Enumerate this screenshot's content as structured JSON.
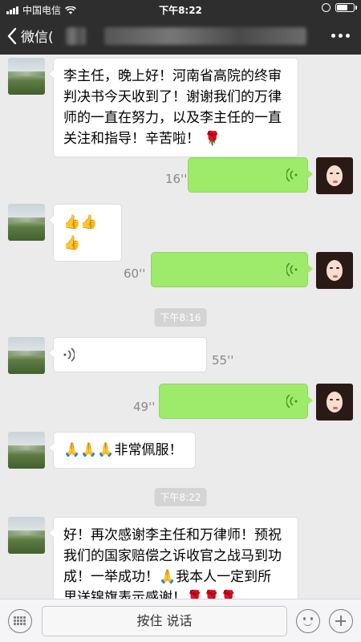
{
  "status_bar": {
    "carrier": "中国电信",
    "time": "下午8:22"
  },
  "nav": {
    "back_label": "微信(",
    "more_icon": "more-dots-icon"
  },
  "messages": [
    {
      "type": "text",
      "side": "left",
      "lines": [
        "李主任，晚上好！河南省高院的终审",
        "判决书今天收到了！谢谢我们的万律",
        "师的一直在努力，以及李主任的一直",
        "关注和指导！辛苦啦！"
      ],
      "emoji": "🌹"
    },
    {
      "type": "voice",
      "side": "right",
      "duration": "16''"
    },
    {
      "type": "emoji",
      "side": "left",
      "text": "👍👍👍"
    },
    {
      "type": "voice",
      "side": "right",
      "duration": "60''"
    },
    {
      "type": "time",
      "text": "下午8:16"
    },
    {
      "type": "voice",
      "side": "left",
      "duration": "55''"
    },
    {
      "type": "voice",
      "side": "right",
      "duration": "49''"
    },
    {
      "type": "text",
      "side": "left",
      "prefix": "🙏🙏🙏",
      "text": "非常佩服！"
    },
    {
      "type": "time",
      "text": "下午8:22"
    },
    {
      "type": "text",
      "side": "left",
      "lines": [
        "好！再次感谢李主任和万律师！预祝",
        "我们的国家赔偿之诉收官之战马到功",
        "成！一举成功！🙏我本人一定到所",
        "里送锦旗表示感谢！🌹🌹🌹"
      ]
    }
  ],
  "toolbar": {
    "talk_label": "按住 说话"
  },
  "colors": {
    "bar_bg": "#2e2e2e",
    "chat_bg": "#ebebeb",
    "sent_bubble": "#9eea6a"
  }
}
